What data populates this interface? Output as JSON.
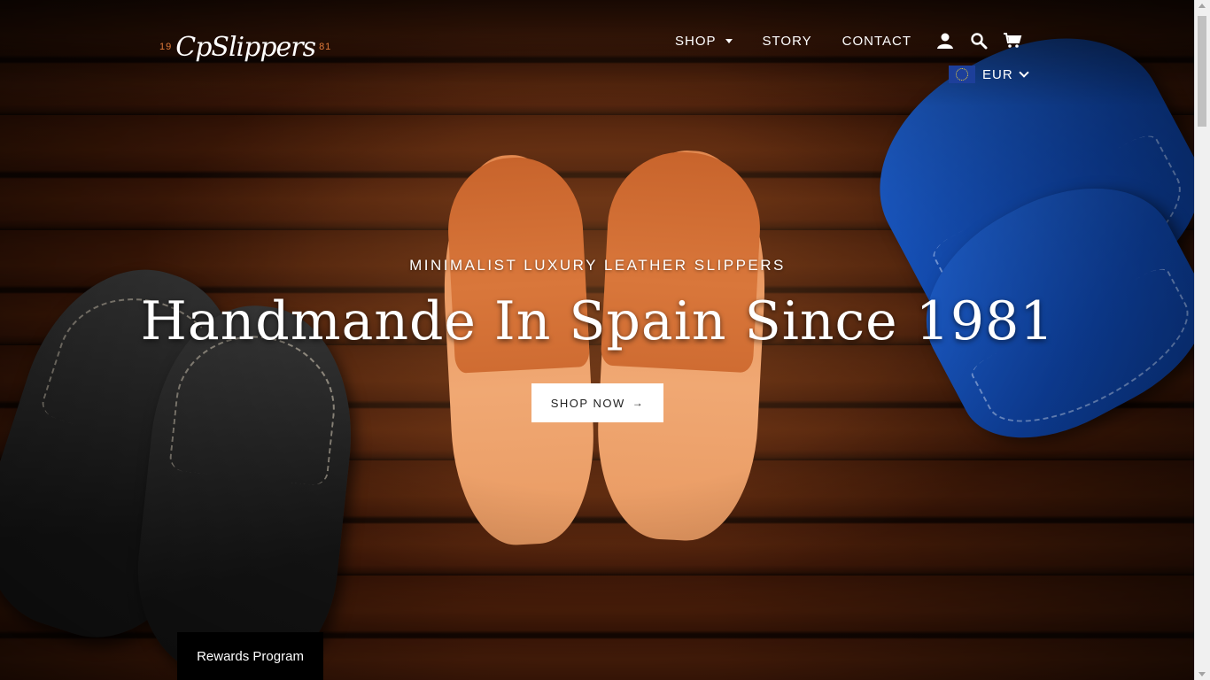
{
  "brand": {
    "logo_year_left": "19",
    "logo_word": "CpSlippers",
    "logo_year_right": "81"
  },
  "nav": {
    "shop": "SHOP",
    "story": "STORY",
    "contact": "CONTACT",
    "icons": [
      "account-icon",
      "search-icon",
      "cart-icon"
    ]
  },
  "currency": {
    "label": "EUR",
    "flag": "eu-flag"
  },
  "hero": {
    "subtitle": "MINIMALIST LUXURY LEATHER SLIPPERS",
    "title": "Handmande In Spain Since 1981",
    "cta_label": "SHOP NOW",
    "cta_arrow": "→"
  },
  "rewards": {
    "label": "Rewards Program"
  },
  "colors": {
    "accent": "#e07a3a",
    "slipper_black": "#1a1a1a",
    "slipper_orange": "#d9773b",
    "slipper_blue": "#0e44a8"
  }
}
